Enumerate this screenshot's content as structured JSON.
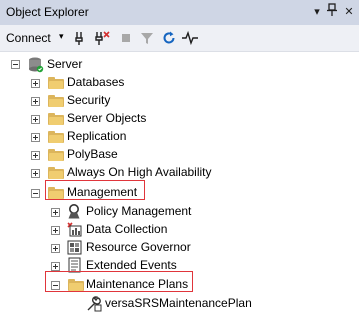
{
  "window": {
    "title": "Object Explorer",
    "pin_glyph": "▾",
    "pushpin_glyph": "⊥",
    "close_glyph": "✕"
  },
  "toolbar": {
    "connect_label": "Connect",
    "connect_caret": "▾"
  },
  "tree": {
    "server": {
      "label": "Server"
    },
    "items": [
      {
        "label": "Databases"
      },
      {
        "label": "Security"
      },
      {
        "label": "Server Objects"
      },
      {
        "label": "Replication"
      },
      {
        "label": "PolyBase"
      },
      {
        "label": "Always On High Availability"
      },
      {
        "label": "Management"
      }
    ],
    "management_children": [
      {
        "label": "Policy Management"
      },
      {
        "label": "Data Collection"
      },
      {
        "label": "Resource Governor"
      },
      {
        "label": "Extended Events"
      },
      {
        "label": "Maintenance Plans"
      }
    ],
    "maintenance_plan": {
      "label": "versaSRSMaintenancePlan"
    }
  },
  "colors": {
    "highlight_border": "#e0353b",
    "folder": "#dcb55c",
    "titlebar": "#cfd6e5"
  }
}
